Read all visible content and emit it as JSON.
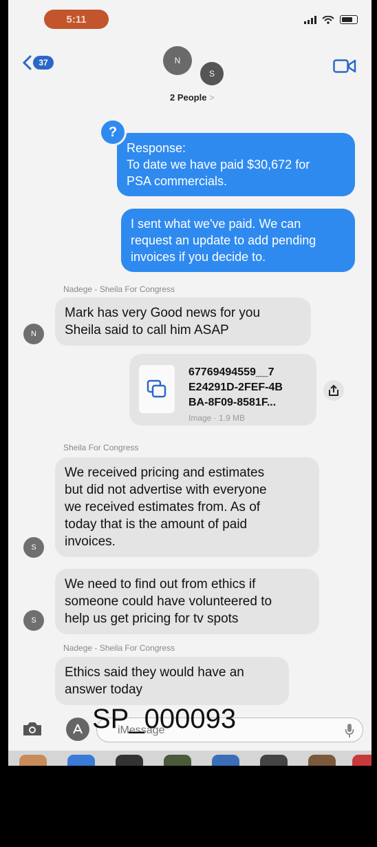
{
  "status_bar": {
    "time": "5:11"
  },
  "header": {
    "back_count": "37",
    "avatar_n": "N",
    "avatar_s": "S",
    "people_label": "2 People",
    "people_chevron": ">"
  },
  "messages": {
    "reaction": "?",
    "out1": [
      "Response:",
      "To date we have paid $30,672 for",
      "PSA commercials."
    ],
    "out2": [
      "I sent what we've paid. We can",
      "request an update to add pending",
      "invoices if you decide to."
    ],
    "sender1": "Nadege - Sheila For Congress",
    "in1": [
      "Mark has very Good news for you",
      "Sheila said to call him ASAP"
    ],
    "in1_avatar": "N",
    "attachment": {
      "name_lines": [
        "67769494559__7",
        "E24291D-2FEF-4B",
        "BA-8F09-8581F..."
      ],
      "meta": "Image · 1.9 MB"
    },
    "sender2": "Sheila For Congress",
    "in2": [
      "We received pricing and estimates",
      "but did not advertise with everyone",
      "we received estimates from. As of",
      "today that is the amount of paid",
      "invoices."
    ],
    "in2_avatar": "S",
    "in3": [
      "We need to find out from ethics if",
      "someone could have volunteered to",
      "help us get pricing for tv spots"
    ],
    "in3_avatar": "S",
    "sender3": "Nadege - Sheila For Congress",
    "in4": [
      "Ethics said they would have an",
      "answer today"
    ]
  },
  "input": {
    "placeholder": "iMessage"
  },
  "bates_stamp": "SP_000093",
  "colors": {
    "outgoing": "#2f8af0",
    "incoming": "#e4e4e4",
    "badge": "#2a68c8"
  }
}
